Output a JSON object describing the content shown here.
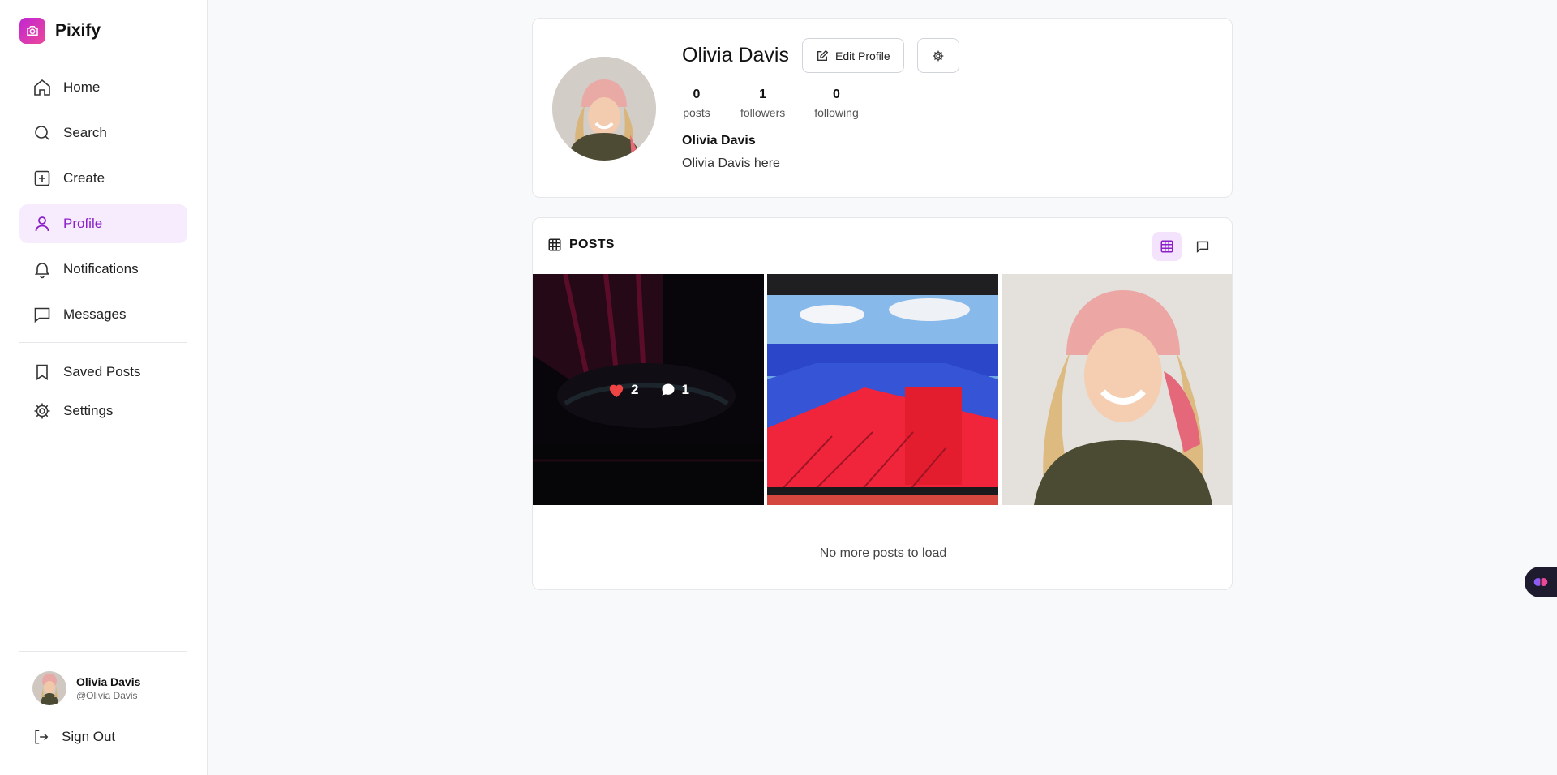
{
  "app": {
    "name": "Pixify"
  },
  "nav": {
    "items": [
      {
        "label": "Home"
      },
      {
        "label": "Search"
      },
      {
        "label": "Create"
      },
      {
        "label": "Profile"
      },
      {
        "label": "Notifications"
      },
      {
        "label": "Messages"
      }
    ],
    "secondary": [
      {
        "label": "Saved Posts"
      },
      {
        "label": "Settings"
      }
    ],
    "active": "Profile"
  },
  "current_user": {
    "name": "Olivia Davis",
    "handle": "@Olivia Davis"
  },
  "signout_label": "Sign Out",
  "profile": {
    "name": "Olivia Davis",
    "edit_label": "Edit Profile",
    "stats": [
      {
        "value": "0",
        "label": "posts"
      },
      {
        "value": "1",
        "label": "followers"
      },
      {
        "value": "0",
        "label": "following"
      }
    ],
    "display_name": "Olivia Davis",
    "bio": "Olivia Davis here"
  },
  "posts": {
    "header": "POSTS",
    "items": [
      {
        "likes": "2",
        "comments": "1"
      },
      {},
      {}
    ],
    "end_message": "No more posts to load"
  },
  "colors": {
    "accent": "#8b1fc9",
    "active_bg": "#f7ecfd",
    "like": "#ef4444"
  }
}
